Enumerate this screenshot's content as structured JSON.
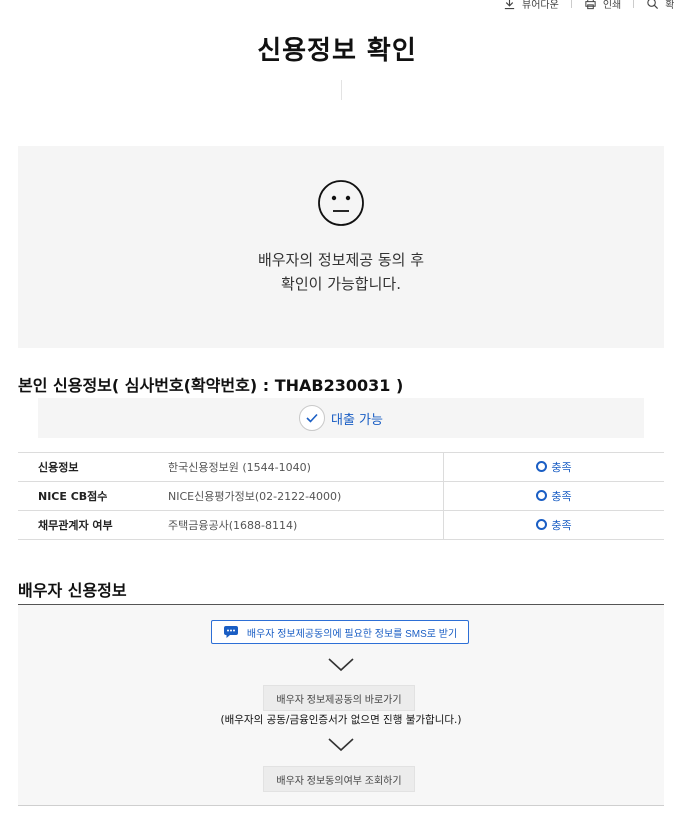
{
  "toolbar": {
    "viewer_download": "뷰어다운",
    "print": "인쇄",
    "zoom": "확"
  },
  "page_title": "신용정보 확인",
  "notice": {
    "line1": "배우자의 정보제공 동의 후",
    "line2": "확인이 가능합니다."
  },
  "self_credit": {
    "heading": "본인 신용정보( 심사번호(확약번호) : THAB230031 )",
    "result": "대출 가능",
    "rows": [
      {
        "label": "신용정보",
        "agency": "한국신용정보원 (1544-1040)",
        "status": "충족"
      },
      {
        "label": "NICE CB점수",
        "agency": "NICE신용평가정보(02-2122-4000)",
        "status": "충족"
      },
      {
        "label": "채무관계자 여부",
        "agency": "주택금융공사(1688-8114)",
        "status": "충족"
      }
    ]
  },
  "spouse_credit": {
    "heading": "배우자 신용정보",
    "sms_button": "배우자 정보제공동의에 필요한 정보를 SMS로 받기",
    "consent_button": "배우자 정보제공동의 바로가기",
    "note": "(배우자의 공동/금융인증서가 없으면 진행 불가합니다.)",
    "check_button": "배우자 정보동의여부 조회하기"
  },
  "colors": {
    "accent_blue": "#1a5ec4",
    "panel_gray": "#f5f5f5"
  }
}
